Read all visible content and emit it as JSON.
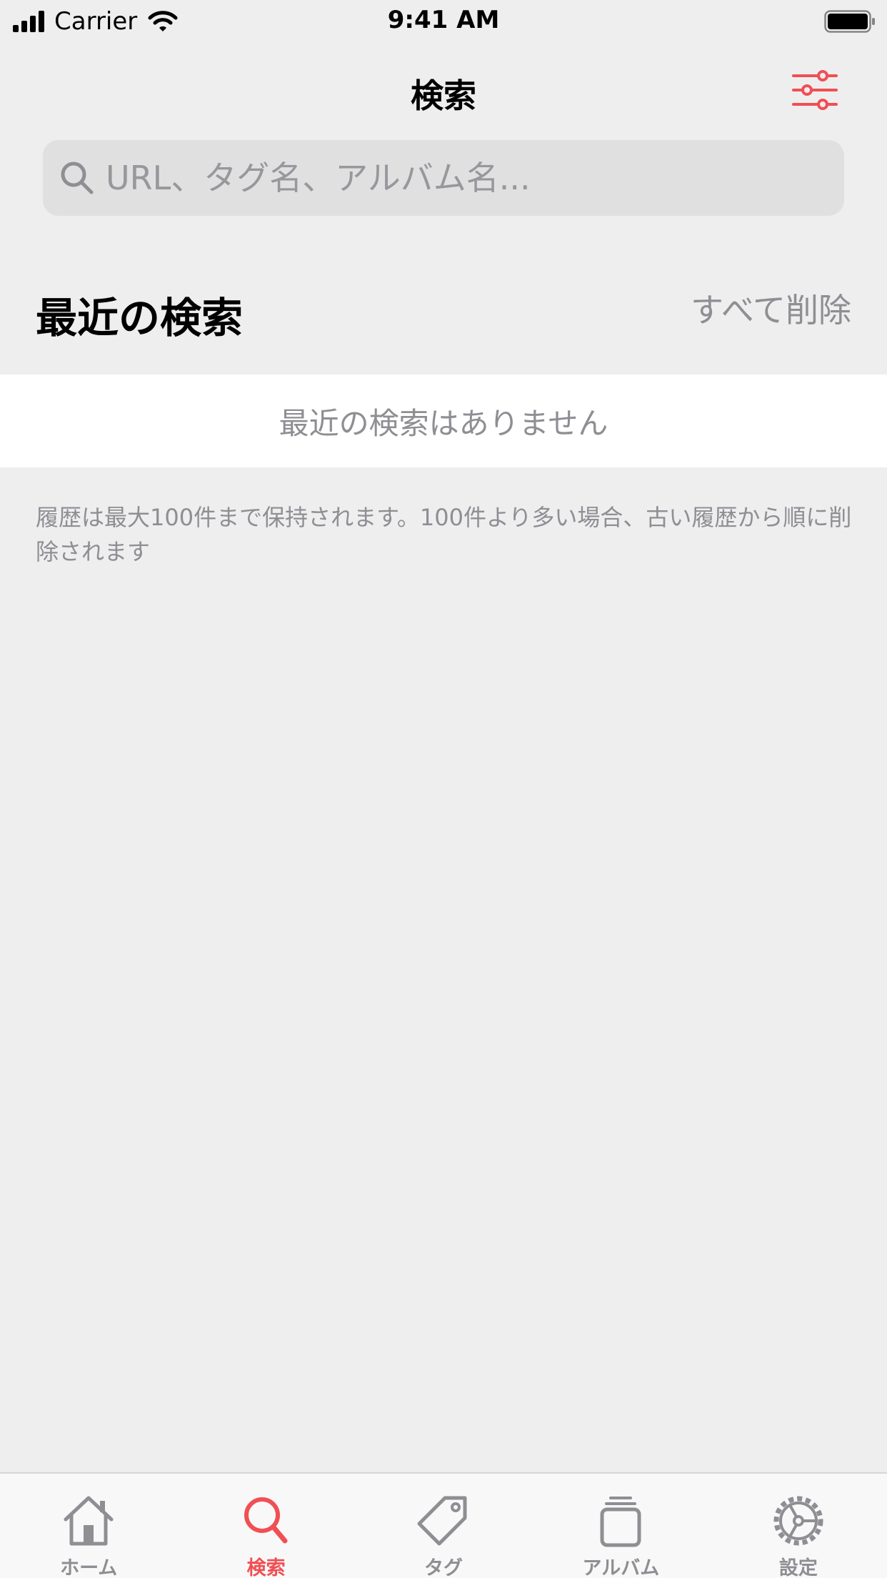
{
  "status_bar": {
    "carrier": "Carrier",
    "time": "9:41 AM"
  },
  "nav": {
    "title": "検索",
    "filter_icon": "sliders-icon"
  },
  "search": {
    "placeholder": "URL、タグ名、アルバム名...",
    "value": ""
  },
  "recent": {
    "title": "最近の検索",
    "clear_all": "すべて削除",
    "empty_message": "最近の検索はありません",
    "footnote": "履歴は最大100件まで保持されます。100件より多い場合、古い履歴から順に削除されます"
  },
  "tabs": [
    {
      "label": "ホーム",
      "icon": "home-icon",
      "active": false
    },
    {
      "label": "検索",
      "icon": "search-icon",
      "active": true
    },
    {
      "label": "タグ",
      "icon": "tag-icon",
      "active": false
    },
    {
      "label": "アルバム",
      "icon": "album-icon",
      "active": false
    },
    {
      "label": "設定",
      "icon": "gear-icon",
      "active": false
    }
  ],
  "colors": {
    "accent": "#F04F54",
    "background": "#EEEEEF",
    "secondary_text": "#8E8E93",
    "search_field": "#E0E0E1"
  }
}
